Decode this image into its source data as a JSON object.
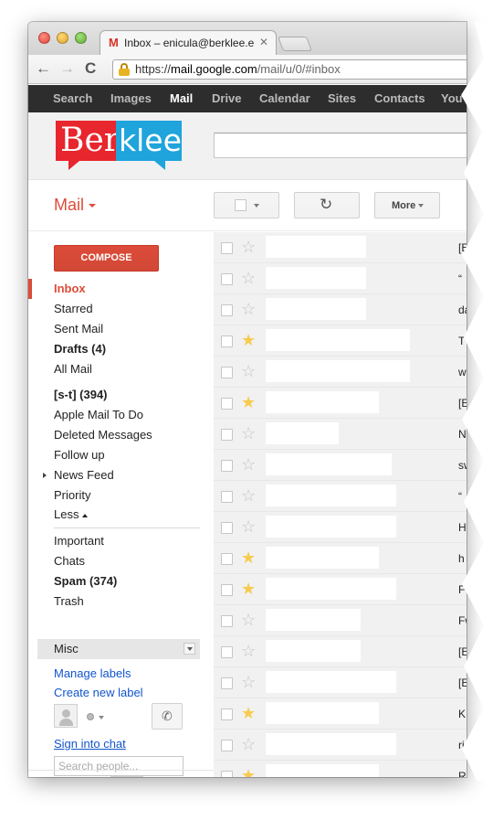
{
  "browser": {
    "tab": {
      "favicon": "M",
      "title": "Inbox – enicula@berklee.e",
      "close": "✕"
    },
    "nav": {
      "back": "←",
      "forward": "→",
      "reload": "C"
    },
    "url": {
      "scheme": "https://",
      "host": "mail.google.com",
      "path": "/mail/u/0/#inbox"
    }
  },
  "gbar": {
    "items": [
      "Search",
      "Images",
      "Mail",
      "Drive",
      "Calendar",
      "Sites",
      "Contacts",
      "YouTu"
    ],
    "active": "Mail"
  },
  "brand": {
    "logo_left": "Ber",
    "logo_right": "klee",
    "colors": {
      "red": "#e8262d",
      "blue": "#1fa4dc"
    }
  },
  "toolbar": {
    "mail_label": "Mail",
    "refresh_icon": "↻",
    "more_label": "More"
  },
  "sidebar": {
    "compose_label": "COMPOSE",
    "primary": [
      {
        "label": "Inbox",
        "state": "active"
      },
      {
        "label": "Starred",
        "state": "normal"
      },
      {
        "label": "Sent Mail",
        "state": "normal"
      },
      {
        "label": "Drafts (4)",
        "state": "bold"
      },
      {
        "label": "All Mail",
        "state": "normal"
      }
    ],
    "labels": [
      {
        "label": "[s-t] (394)",
        "state": "bold"
      },
      {
        "label": "Apple Mail To Do",
        "state": "normal"
      },
      {
        "label": "Deleted Messages",
        "state": "normal"
      },
      {
        "label": "Follow up",
        "state": "normal"
      },
      {
        "label": "News Feed",
        "state": "expandable"
      },
      {
        "label": "Priority",
        "state": "normal"
      },
      {
        "label": "Less",
        "state": "toggle"
      }
    ],
    "system": [
      {
        "label": "Important",
        "state": "normal"
      },
      {
        "label": "Chats",
        "state": "normal"
      },
      {
        "label": "Spam (374)",
        "state": "bold"
      },
      {
        "label": "Trash",
        "state": "normal"
      }
    ],
    "section_title": "Misc",
    "manage_labels": "Manage labels",
    "create_label": "Create new label",
    "sign_in_chat": "Sign into chat",
    "search_people_placeholder": "Search people..."
  },
  "messages": [
    {
      "starred": false,
      "subject": "[Elisa"
    },
    {
      "starred": false,
      "subject": "“"
    },
    {
      "starred": false,
      "subject": "datele"
    },
    {
      "starred": true,
      "subject": "T"
    },
    {
      "starred": false,
      "subject": "weba"
    },
    {
      "starred": true,
      "subject": "[El"
    },
    {
      "starred": false,
      "subject": "Ne"
    },
    {
      "starred": false,
      "subject": "swar"
    },
    {
      "starred": false,
      "subject": "“"
    },
    {
      "starred": false,
      "subject": "Health"
    },
    {
      "starred": true,
      "subject": "h"
    },
    {
      "starred": true,
      "subject": "Fwo"
    },
    {
      "starred": false,
      "subject": "Fwi"
    },
    {
      "starred": false,
      "subject": "[E"
    },
    {
      "starred": false,
      "subject": "[Elisa"
    },
    {
      "starred": true,
      "subject": "K"
    },
    {
      "starred": false,
      "subject": "right co"
    },
    {
      "starred": true,
      "subject": "R"
    }
  ]
}
